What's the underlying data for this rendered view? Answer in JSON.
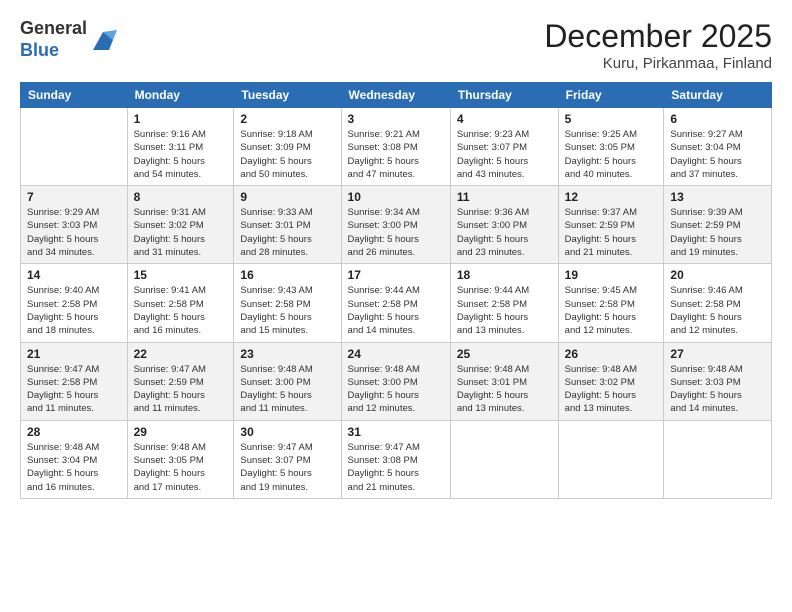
{
  "logo": {
    "line1": "General",
    "line2": "Blue"
  },
  "title": "December 2025",
  "subtitle": "Kuru, Pirkanmaa, Finland",
  "days_header": [
    "Sunday",
    "Monday",
    "Tuesday",
    "Wednesday",
    "Thursday",
    "Friday",
    "Saturday"
  ],
  "weeks": [
    [
      {
        "num": "",
        "info": ""
      },
      {
        "num": "1",
        "info": "Sunrise: 9:16 AM\nSunset: 3:11 PM\nDaylight: 5 hours\nand 54 minutes."
      },
      {
        "num": "2",
        "info": "Sunrise: 9:18 AM\nSunset: 3:09 PM\nDaylight: 5 hours\nand 50 minutes."
      },
      {
        "num": "3",
        "info": "Sunrise: 9:21 AM\nSunset: 3:08 PM\nDaylight: 5 hours\nand 47 minutes."
      },
      {
        "num": "4",
        "info": "Sunrise: 9:23 AM\nSunset: 3:07 PM\nDaylight: 5 hours\nand 43 minutes."
      },
      {
        "num": "5",
        "info": "Sunrise: 9:25 AM\nSunset: 3:05 PM\nDaylight: 5 hours\nand 40 minutes."
      },
      {
        "num": "6",
        "info": "Sunrise: 9:27 AM\nSunset: 3:04 PM\nDaylight: 5 hours\nand 37 minutes."
      }
    ],
    [
      {
        "num": "7",
        "info": "Sunrise: 9:29 AM\nSunset: 3:03 PM\nDaylight: 5 hours\nand 34 minutes."
      },
      {
        "num": "8",
        "info": "Sunrise: 9:31 AM\nSunset: 3:02 PM\nDaylight: 5 hours\nand 31 minutes."
      },
      {
        "num": "9",
        "info": "Sunrise: 9:33 AM\nSunset: 3:01 PM\nDaylight: 5 hours\nand 28 minutes."
      },
      {
        "num": "10",
        "info": "Sunrise: 9:34 AM\nSunset: 3:00 PM\nDaylight: 5 hours\nand 26 minutes."
      },
      {
        "num": "11",
        "info": "Sunrise: 9:36 AM\nSunset: 3:00 PM\nDaylight: 5 hours\nand 23 minutes."
      },
      {
        "num": "12",
        "info": "Sunrise: 9:37 AM\nSunset: 2:59 PM\nDaylight: 5 hours\nand 21 minutes."
      },
      {
        "num": "13",
        "info": "Sunrise: 9:39 AM\nSunset: 2:59 PM\nDaylight: 5 hours\nand 19 minutes."
      }
    ],
    [
      {
        "num": "14",
        "info": "Sunrise: 9:40 AM\nSunset: 2:58 PM\nDaylight: 5 hours\nand 18 minutes."
      },
      {
        "num": "15",
        "info": "Sunrise: 9:41 AM\nSunset: 2:58 PM\nDaylight: 5 hours\nand 16 minutes."
      },
      {
        "num": "16",
        "info": "Sunrise: 9:43 AM\nSunset: 2:58 PM\nDaylight: 5 hours\nand 15 minutes."
      },
      {
        "num": "17",
        "info": "Sunrise: 9:44 AM\nSunset: 2:58 PM\nDaylight: 5 hours\nand 14 minutes."
      },
      {
        "num": "18",
        "info": "Sunrise: 9:44 AM\nSunset: 2:58 PM\nDaylight: 5 hours\nand 13 minutes."
      },
      {
        "num": "19",
        "info": "Sunrise: 9:45 AM\nSunset: 2:58 PM\nDaylight: 5 hours\nand 12 minutes."
      },
      {
        "num": "20",
        "info": "Sunrise: 9:46 AM\nSunset: 2:58 PM\nDaylight: 5 hours\nand 12 minutes."
      }
    ],
    [
      {
        "num": "21",
        "info": "Sunrise: 9:47 AM\nSunset: 2:58 PM\nDaylight: 5 hours\nand 11 minutes."
      },
      {
        "num": "22",
        "info": "Sunrise: 9:47 AM\nSunset: 2:59 PM\nDaylight: 5 hours\nand 11 minutes."
      },
      {
        "num": "23",
        "info": "Sunrise: 9:48 AM\nSunset: 3:00 PM\nDaylight: 5 hours\nand 11 minutes."
      },
      {
        "num": "24",
        "info": "Sunrise: 9:48 AM\nSunset: 3:00 PM\nDaylight: 5 hours\nand 12 minutes."
      },
      {
        "num": "25",
        "info": "Sunrise: 9:48 AM\nSunset: 3:01 PM\nDaylight: 5 hours\nand 13 minutes."
      },
      {
        "num": "26",
        "info": "Sunrise: 9:48 AM\nSunset: 3:02 PM\nDaylight: 5 hours\nand 13 minutes."
      },
      {
        "num": "27",
        "info": "Sunrise: 9:48 AM\nSunset: 3:03 PM\nDaylight: 5 hours\nand 14 minutes."
      }
    ],
    [
      {
        "num": "28",
        "info": "Sunrise: 9:48 AM\nSunset: 3:04 PM\nDaylight: 5 hours\nand 16 minutes."
      },
      {
        "num": "29",
        "info": "Sunrise: 9:48 AM\nSunset: 3:05 PM\nDaylight: 5 hours\nand 17 minutes."
      },
      {
        "num": "30",
        "info": "Sunrise: 9:47 AM\nSunset: 3:07 PM\nDaylight: 5 hours\nand 19 minutes."
      },
      {
        "num": "31",
        "info": "Sunrise: 9:47 AM\nSunset: 3:08 PM\nDaylight: 5 hours\nand 21 minutes."
      },
      {
        "num": "",
        "info": ""
      },
      {
        "num": "",
        "info": ""
      },
      {
        "num": "",
        "info": ""
      }
    ]
  ]
}
